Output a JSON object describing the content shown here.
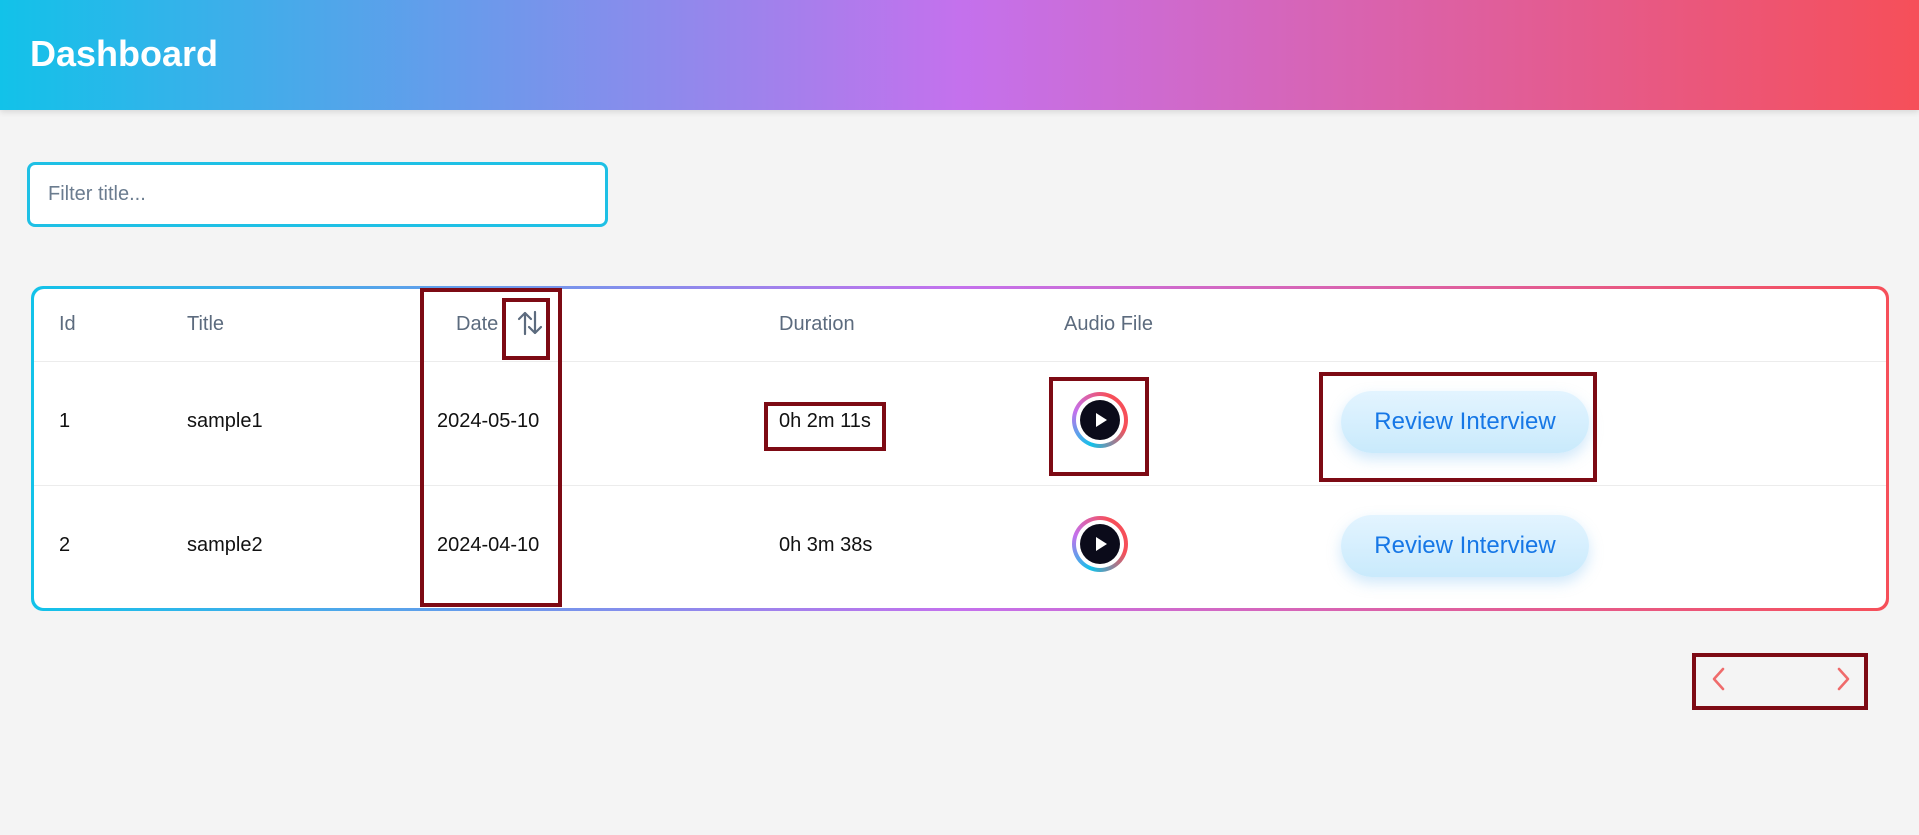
{
  "header": {
    "title": "Dashboard"
  },
  "filter": {
    "placeholder": "Filter title...",
    "value": ""
  },
  "table": {
    "columns": {
      "id": "Id",
      "title": "Title",
      "date": "Date",
      "duration": "Duration",
      "audio": "Audio File"
    },
    "rows": [
      {
        "id": "1",
        "title": "sample1",
        "date": "2024-05-10",
        "duration": "0h 2m 11s",
        "action": "Review Interview"
      },
      {
        "id": "2",
        "title": "sample2",
        "date": "2024-04-10",
        "duration": "0h 3m 38s",
        "action": "Review Interview"
      }
    ]
  },
  "icons": {
    "sort": "sort-up-down-icon",
    "play": "play-icon",
    "prev": "chevron-left-icon",
    "next": "chevron-right-icon"
  },
  "colors": {
    "gradient_start": "#12c2e9",
    "gradient_mid": "#c471ed",
    "gradient_end": "#f64f59",
    "button_text": "#1677e6",
    "pager_arrow": "#ef6b6b",
    "highlight": "#7d0a14"
  }
}
